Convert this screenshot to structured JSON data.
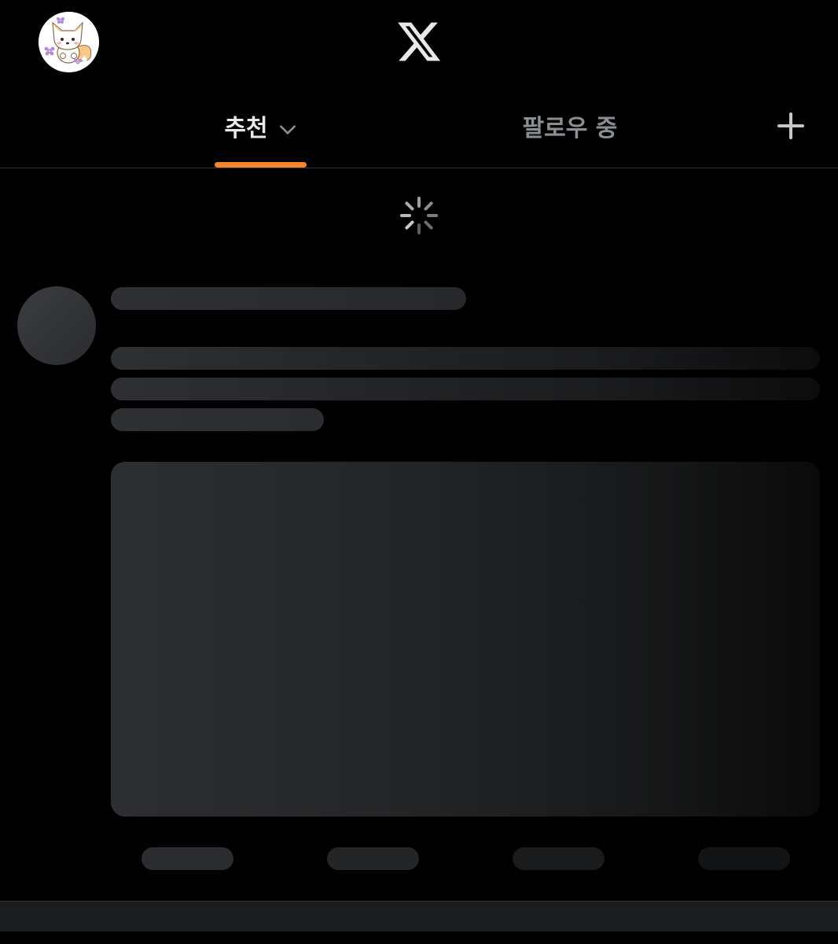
{
  "header": {
    "profile_avatar_icon": "fox-avatar-icon",
    "logo_icon": "x-logo-icon"
  },
  "tabs": {
    "items": [
      {
        "label": "추천",
        "active": true,
        "has_dropdown": true
      },
      {
        "label": "팔로우 중",
        "active": false
      }
    ],
    "add_icon": "plus-icon"
  },
  "feed": {
    "loading_icon": "loading-spinner-icon"
  },
  "colors": {
    "background": "#000000",
    "active_tab_indicator": "#f5842e",
    "active_tab_text": "#e7e9ea",
    "inactive_tab_text": "#8b8f94",
    "skeleton": "#2e3034",
    "divider": "#2f3336"
  }
}
